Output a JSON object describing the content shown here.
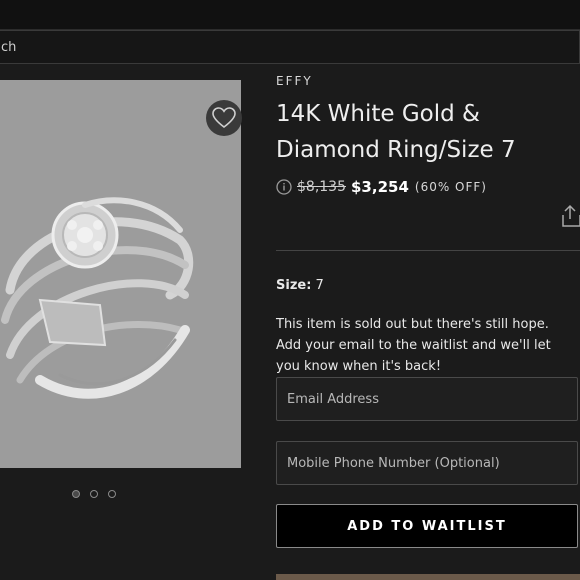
{
  "search": {
    "placeholder": "ch"
  },
  "product": {
    "brand": "EFFY",
    "title": "14K White Gold & Diamond Ring/Size 7",
    "original_price": "$8,135",
    "sale_price": "$3,254",
    "discount": "(60% OFF)",
    "size_label": "Size:",
    "size_value": "7",
    "soldout_message": "This item is sold out but there's still hope. Add your email to the waitlist and we'll let you know when it's back!"
  },
  "form": {
    "email_placeholder": "Email Address",
    "phone_placeholder": "Mobile Phone Number (Optional)",
    "submit_label": "ADD TO WAITLIST"
  },
  "gallery": {
    "dot_count": 3,
    "active_index": 0
  },
  "icons": {
    "wishlist": "heart-icon",
    "info": "info-icon",
    "share": "share-icon"
  },
  "colors": {
    "background": "#1b1b1b",
    "image_background": "#9c9c9c",
    "button_background": "#000000",
    "accent_text": "#ffffff"
  }
}
